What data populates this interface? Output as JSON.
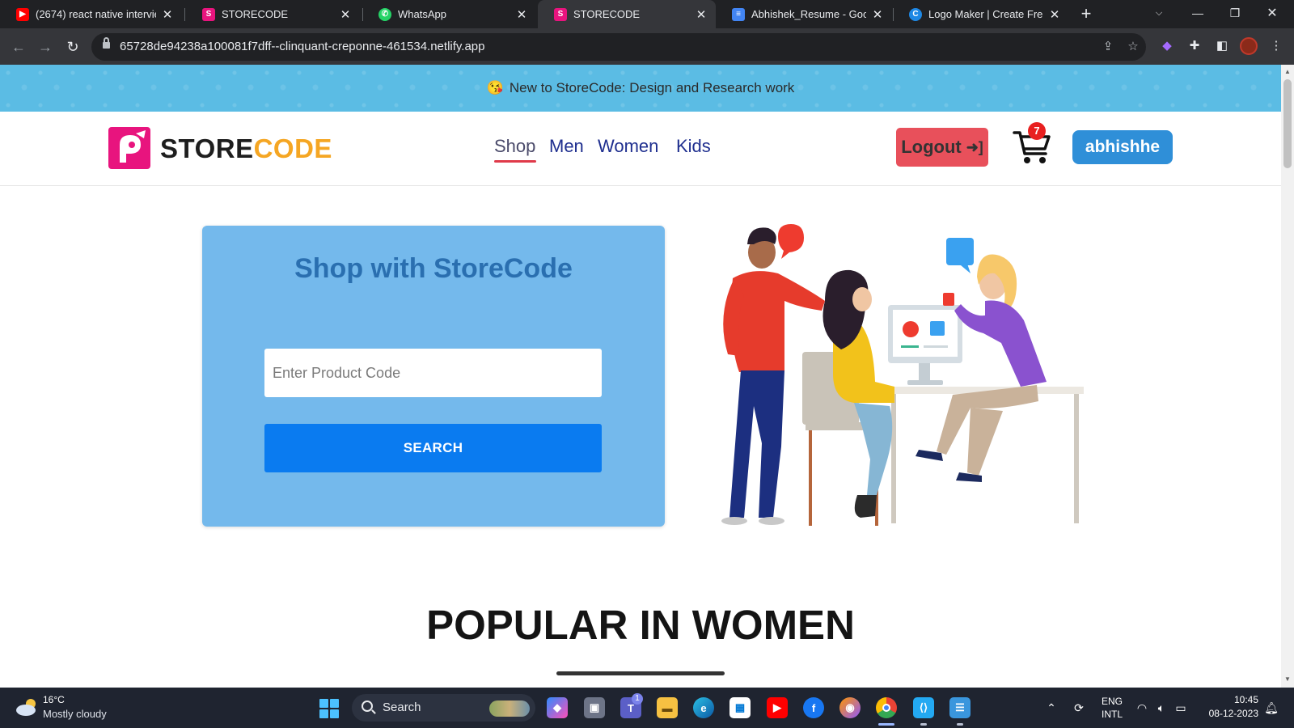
{
  "browser": {
    "tabs": [
      {
        "title": "(2674) react native intervie",
        "icon": "youtube-icon",
        "color": "#ff0000"
      },
      {
        "title": "STORECODE",
        "icon": "storecode-icon",
        "color": "#e8147e"
      },
      {
        "title": "WhatsApp",
        "icon": "whatsapp-icon",
        "color": "#25d366"
      },
      {
        "title": "STORECODE",
        "icon": "storecode-icon",
        "color": "#e8147e"
      },
      {
        "title": "Abhishek_Resume - Googl",
        "icon": "google-docs-icon",
        "color": "#4285f4"
      },
      {
        "title": "Logo Maker | Create Free L",
        "icon": "logo-maker-icon",
        "color": "#1e88e5"
      }
    ],
    "active_tab": 3,
    "url": "65728de94238a100081f7dff--clinquant-creponne-461534.netlify.app"
  },
  "announcement": {
    "emoji": "😘",
    "text": "New to StoreCode: Design and Research work"
  },
  "header": {
    "logo_store": "STORE",
    "logo_code": "CODE",
    "nav": [
      "Shop",
      "Men",
      "Women",
      "Kids"
    ],
    "active_nav": "Shop",
    "logout_label": "Logout",
    "cart_count": "7",
    "username": "abhishhe"
  },
  "hero": {
    "title": "Shop with StoreCode",
    "input_placeholder": "Enter Product Code",
    "search_label": "SEARCH"
  },
  "section": {
    "title": "POPULAR IN WOMEN"
  },
  "taskbar": {
    "temperature": "16°C",
    "weather": "Mostly cloudy",
    "search_label": "Search",
    "teams_badge": "1",
    "lang_line1": "ENG",
    "lang_line2": "INTL",
    "time": "10:45",
    "date": "08-12-2023"
  },
  "colors": {
    "brand_pink": "#e8147e",
    "brand_orange": "#f5a623",
    "announce_bg": "#5bbce4",
    "card_bg": "#74b9ec",
    "search_button": "#0a7bf0",
    "logout_bg": "#e8505b",
    "user_button": "#2f8fd8"
  }
}
